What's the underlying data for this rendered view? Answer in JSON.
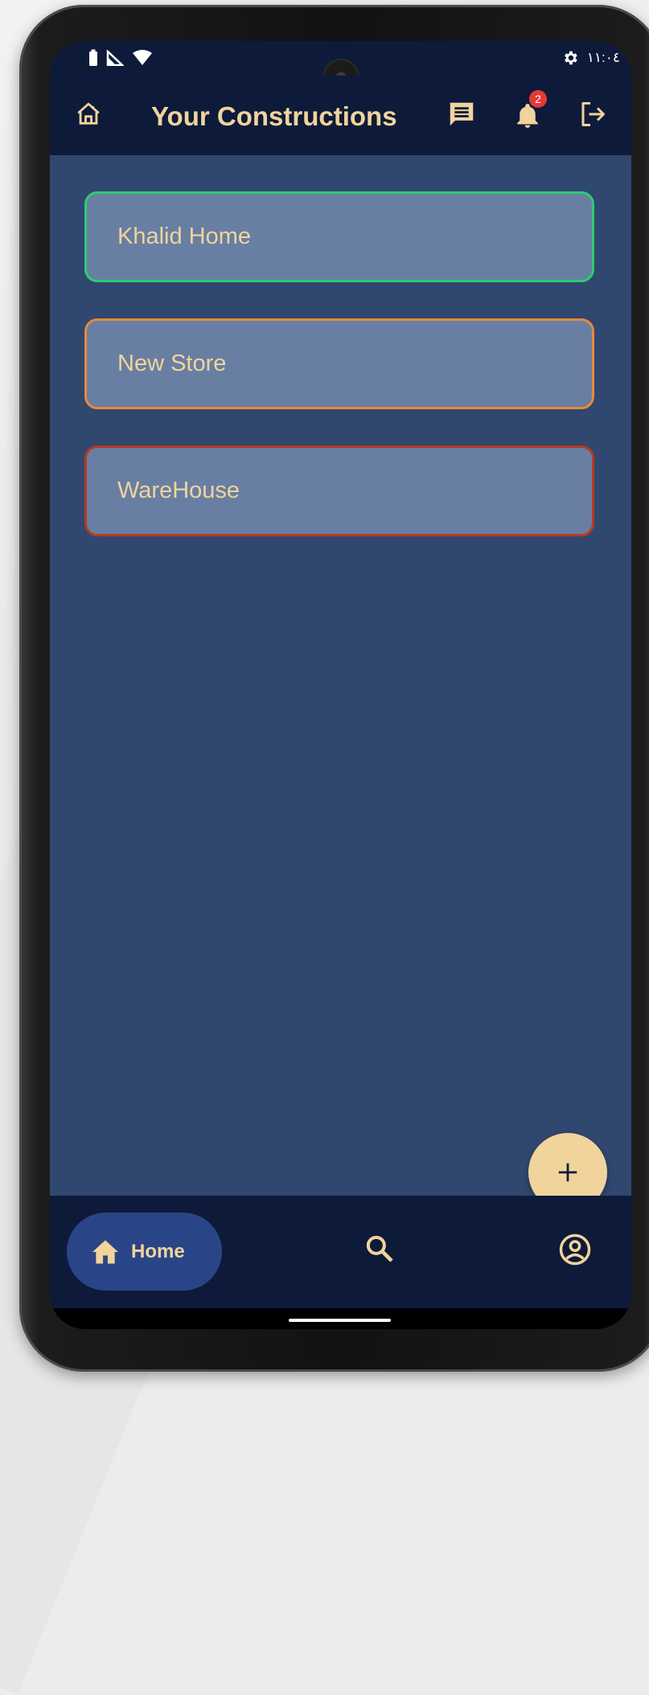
{
  "status_bar": {
    "time": "١١:٠٤",
    "icons": [
      "battery-icon",
      "signal-icon",
      "wifi-icon",
      "settings-gear-icon"
    ]
  },
  "app_bar": {
    "title": "Your Constructions",
    "home_icon": "home-outline-icon",
    "chat_icon": "chat-message-icon",
    "notifications_icon": "bell-icon",
    "notification_count": "2",
    "logout_icon": "logout-icon"
  },
  "projects": [
    {
      "name": "Khalid Home",
      "status_color": "#2ecc71"
    },
    {
      "name": "New Store",
      "status_color": "#e8893a"
    },
    {
      "name": "WareHouse",
      "status_color": "#b83a1f"
    }
  ],
  "fab": {
    "icon": "plus-icon"
  },
  "bottom_nav": {
    "home_label": "Home",
    "home_icon": "home-filled-icon",
    "search_icon": "search-icon",
    "profile_icon": "profile-circle-icon"
  },
  "colors": {
    "app_bar_bg": "#0e1a3a",
    "content_bg": "#30476f",
    "card_bg": "#687fa3",
    "accent_text": "#f1d49c",
    "nav_active_pill": "#2a4587",
    "badge": "#e53935"
  }
}
